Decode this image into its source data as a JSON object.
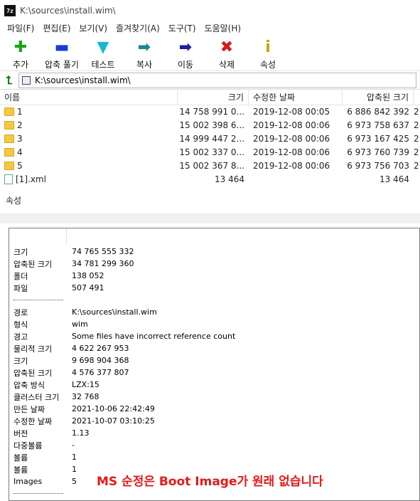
{
  "window": {
    "title": "K:\\sources\\install.wim\\",
    "app_icon_text": "7z"
  },
  "menu": [
    "파일(F)",
    "편집(E)",
    "보기(V)",
    "즐겨찾기(A)",
    "도구(T)",
    "도움말(H)"
  ],
  "toolbar": [
    {
      "label": "추가",
      "icon": "add-icon",
      "glyph": "✚",
      "color": "#16a516"
    },
    {
      "label": "압축 풀기",
      "icon": "extract-icon",
      "glyph": "▬",
      "color": "#1a3bd6"
    },
    {
      "label": "테스트",
      "icon": "test-icon",
      "glyph": "▼",
      "color": "#19b8d0"
    },
    {
      "label": "복사",
      "icon": "copy-icon",
      "glyph": "➡",
      "color": "#1c8a8a"
    },
    {
      "label": "이동",
      "icon": "move-icon",
      "glyph": "➡",
      "color": "#1b1f9a"
    },
    {
      "label": "삭제",
      "icon": "delete-icon",
      "glyph": "✖",
      "color": "#d61a1a"
    },
    {
      "label": "속성",
      "icon": "info-icon",
      "glyph": "i",
      "color": "#c9a400"
    }
  ],
  "address": {
    "path": "K:\\sources\\install.wim\\"
  },
  "list": {
    "headers": {
      "name": "이름",
      "size": "크기",
      "modified": "수정한 날짜",
      "packed": "압축된 크기",
      "extra": ""
    },
    "rows": [
      {
        "type": "folder",
        "name": "1",
        "size": "14 758 991 0...",
        "modified": "2019-12-08 00:05",
        "packed": "6 886 842 392",
        "extra": "2"
      },
      {
        "type": "folder",
        "name": "2",
        "size": "15 002 398 6...",
        "modified": "2019-12-08 00:06",
        "packed": "6 973 758 637",
        "extra": "2"
      },
      {
        "type": "folder",
        "name": "3",
        "size": "14 999 447 2...",
        "modified": "2019-12-08 00:06",
        "packed": "6 973 167 425",
        "extra": "2"
      },
      {
        "type": "folder",
        "name": "4",
        "size": "15 002 337 0...",
        "modified": "2019-12-08 00:06",
        "packed": "6 973 760 739",
        "extra": "2"
      },
      {
        "type": "folder",
        "name": "5",
        "size": "15 002 367 8...",
        "modified": "2019-12-08 00:06",
        "packed": "6 973 756 703",
        "extra": "2"
      },
      {
        "type": "file",
        "name": "[1].xml",
        "size": "13 464",
        "modified": "",
        "packed": "13 464",
        "extra": ""
      }
    ]
  },
  "properties": {
    "title": "속성",
    "group1": [
      {
        "label": "크기",
        "value": "74 765 555 332"
      },
      {
        "label": "압축된 크기",
        "value": "34 781 299 360"
      },
      {
        "label": "폴더",
        "value": "138 052"
      },
      {
        "label": "파일",
        "value": "507 491"
      }
    ],
    "group2": [
      {
        "label": "경로",
        "value": "K:\\sources\\install.wim"
      },
      {
        "label": "형식",
        "value": "wim"
      },
      {
        "label": "경고",
        "value": "Some files have incorrect reference count"
      },
      {
        "label": "물리적 크기",
        "value": "4 622 267 953"
      },
      {
        "label": "크기",
        "value": "9 698 904 368"
      },
      {
        "label": "압축된 크기",
        "value": "4 576 377 807"
      },
      {
        "label": "압축 방식",
        "value": "LZX:15"
      },
      {
        "label": "클러스터 크기",
        "value": "32 768"
      },
      {
        "label": "만든 날짜",
        "value": "2021-10-06 22:42:49"
      },
      {
        "label": "수정한 날짜",
        "value": "2021-10-07 03:10:25"
      },
      {
        "label": "버전",
        "value": "1.13"
      },
      {
        "label": "다중볼륨",
        "value": "-"
      },
      {
        "label": "볼륨",
        "value": "1"
      },
      {
        "label": "볼륨",
        "value": "1"
      },
      {
        "label": "Images",
        "value": "5"
      }
    ]
  },
  "overlay_text": "MS 순정은 Boot Image가 원래 없습니다"
}
